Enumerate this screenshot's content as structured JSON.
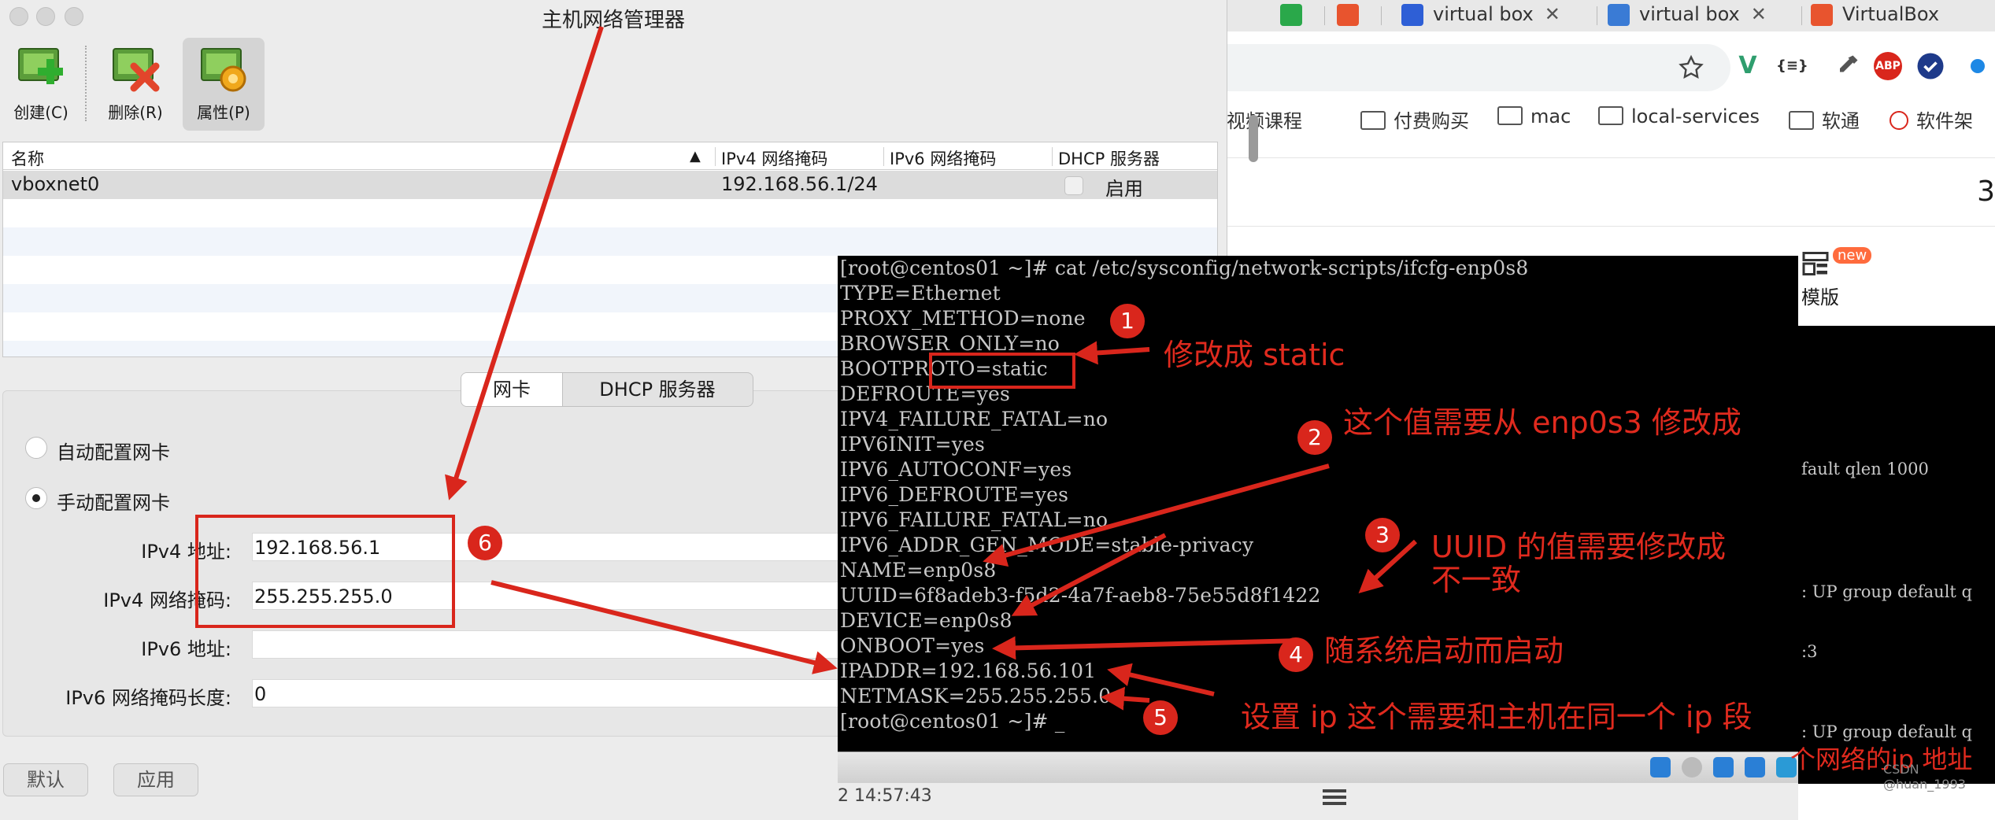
{
  "vbox": {
    "title": "主机网络管理器",
    "toolbar": {
      "create": "创建(C)",
      "delete": "删除(R)",
      "properties": "属性(P)"
    },
    "table": {
      "headers": [
        "名称",
        "IPv4 网络掩码",
        "IPv6 网络掩码",
        "DHCP 服务器"
      ],
      "sort_indicator": "▲",
      "row": {
        "name": "vboxnet0",
        "ipv4": "192.168.56.1/24",
        "ipv6": "",
        "dhcp": "启用"
      }
    },
    "tabs": [
      "网卡",
      "DHCP 服务器"
    ],
    "radios": {
      "auto": "自动配置网卡",
      "manual": "手动配置网卡"
    },
    "fields": {
      "ipv4_addr_label": "IPv4 地址:",
      "ipv4_addr_value": "192.168.56.1",
      "ipv4_mask_label": "IPv4 网络掩码:",
      "ipv4_mask_value": "255.255.255.0",
      "ipv6_addr_label": "IPv6 地址:",
      "ipv6_addr_value": "",
      "ipv6_mask_label": "IPv6 网络掩码长度:",
      "ipv6_mask_value": "0"
    },
    "buttons": {
      "reset": "默认",
      "apply": "应用"
    },
    "footer_time": "2 14:57:43"
  },
  "browser": {
    "tabs": [
      {
        "label": "",
        "icon": "hl-icon",
        "color": "#2aa84a"
      },
      {
        "label": "",
        "icon": "csdn-icon",
        "color": "#e8542e"
      },
      {
        "label": "virtual box",
        "icon": "baidu-icon",
        "color": "#2e5fd6"
      },
      {
        "label": "virtual box",
        "icon": "user-icon",
        "color": "#3a7bd5"
      },
      {
        "label": "VirtualBox",
        "icon": "csdn-icon",
        "color": "#e8542e"
      }
    ],
    "close_glyph": "✕",
    "bookmarks": [
      "视频课程",
      "付费购买",
      "mac",
      "local-services",
      "软通",
      "软件架"
    ],
    "page_digit": "3",
    "template_label": "模版",
    "new_badge": "new",
    "ext_vue": "V",
    "ext_json": "{≡}",
    "ext_abp": "ABP"
  },
  "terminal": {
    "lines": [
      "[root@centos01 ~]# cat /etc/sysconfig/network-scripts/ifcfg-enp0s8",
      "TYPE=Ethernet",
      "PROXY_METHOD=none",
      "BROWSER_ONLY=no",
      "BOOTPROTO=static",
      "DEFROUTE=yes",
      "IPV4_FAILURE_FATAL=no",
      "IPV6INIT=yes",
      "IPV6_AUTOCONF=yes",
      "IPV6_DEFROUTE=yes",
      "IPV6_FAILURE_FATAL=no",
      "IPV6_ADDR_GEN_MODE=stable-privacy",
      "NAME=enp0s8",
      "UUID=6f8adeb3-f5d2-4a7f-aeb8-75e55d8f1422",
      "DEVICE=enp0s8",
      "ONBOOT=yes",
      "IPADDR=192.168.56.101",
      "NETMASK=255.255.255.0",
      "[root@centos01 ~]# _"
    ],
    "side_lines": [
      "fault qlen 1000",
      ": UP group default q",
      ":3",
      ": UP group default q"
    ]
  },
  "annotations": {
    "n1": "1",
    "t1": "修改成 static",
    "n2": "2",
    "t2": "这个值需要从 enp0s3 修改成",
    "n3": "3",
    "t3a": "UUID 的值需要修改成",
    "t3b": "不一致",
    "n4": "4",
    "t4": "随系统启动而启动",
    "n5": "5",
    "t5": "设置 ip 这个需要和主机在同一个 ip 段",
    "n6": "6",
    "t7": "个网络的ip 地址",
    "watermark": "CSDN @huan_1993",
    "color": "#d9261c"
  }
}
